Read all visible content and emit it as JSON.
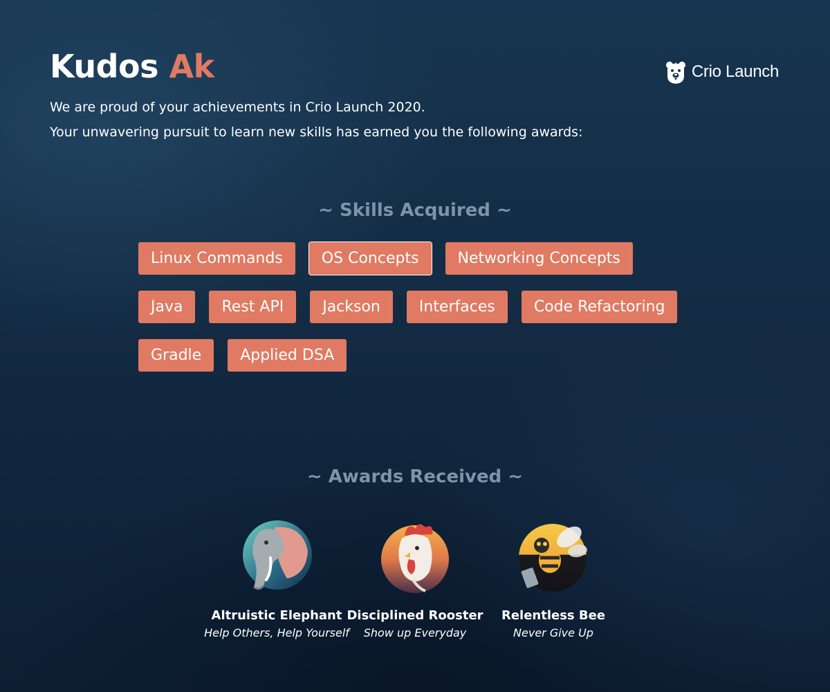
{
  "header": {
    "greeting": "Kudos",
    "name": "Ak",
    "intro_line_1": "We are proud of your achievements in Crio Launch 2020.",
    "intro_line_2": "Your unwavering pursuit to learn new skills has earned you the following awards:"
  },
  "brand": {
    "label": "Crio Launch",
    "icon": "bear-logo-icon"
  },
  "skills": {
    "heading": "~ Skills Acquired ~",
    "selected": "OS Concepts",
    "rows": [
      [
        "Linux Commands",
        "OS Concepts",
        "Networking Concepts"
      ],
      [
        "Java",
        "Rest API",
        "Jackson",
        "Interfaces",
        "Code Refactoring"
      ],
      [
        "Gradle",
        "Applied DSA"
      ]
    ]
  },
  "awards": {
    "heading": "~ Awards Received ~",
    "items": [
      {
        "name": "Altruistic Elephant",
        "tagline": "Help Others, Help Yourself",
        "icon": "elephant-badge-icon"
      },
      {
        "name": "Disciplined Rooster",
        "tagline": "Show up Everyday",
        "icon": "rooster-badge-icon"
      },
      {
        "name": "Relentless Bee",
        "tagline": "Never Give Up",
        "icon": "bee-badge-icon"
      }
    ]
  },
  "colors": {
    "accent": "#e07a63",
    "heading_muted": "#7f94a6",
    "background": "#142c45"
  }
}
